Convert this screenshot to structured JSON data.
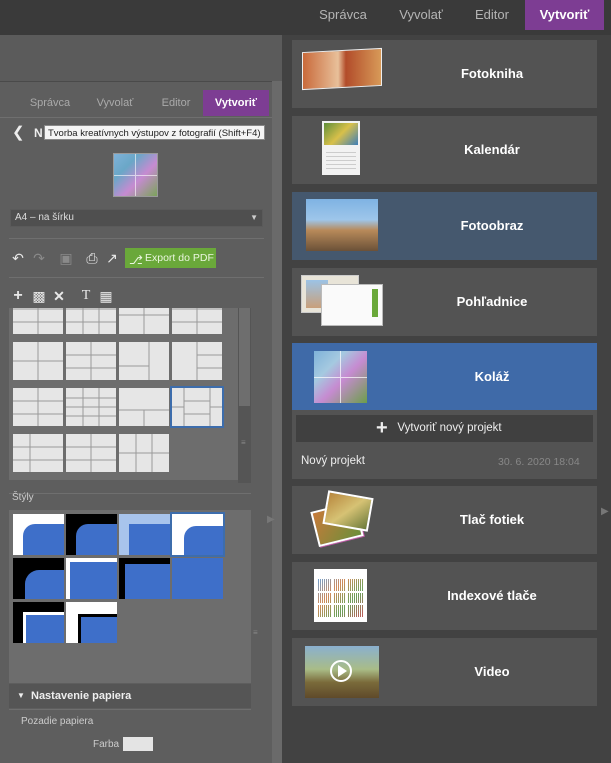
{
  "top_tabs": [
    "Správca",
    "Vyvolať",
    "Editor",
    "Vytvoriť"
  ],
  "panel": {
    "tabs": [
      "Správca",
      "Vyvolať",
      "Editor",
      "Vytvoriť"
    ],
    "title_initial": "N",
    "tooltip": "Tvorba kreatívnych výstupov z fotografií (Shift+F4)",
    "format_select": "A4 – na šírku",
    "export_label": "Export do PDF",
    "styles_label": "Štýly",
    "paper_settings_label": "Nastavenie papiera",
    "paper_background_label": "Pozadie papiera",
    "color_label": "Farba"
  },
  "sidebar": {
    "items": [
      {
        "label": "Fotokniha"
      },
      {
        "label": "Kalendár"
      },
      {
        "label": "Fotoobraz"
      },
      {
        "label": "Pohľadnice"
      },
      {
        "label": "Koláž"
      },
      {
        "label": "Tlač fotiek"
      },
      {
        "label": "Indexové tlače"
      },
      {
        "label": "Video"
      }
    ],
    "create_new_project": "Vytvoriť nový projekt",
    "project_name": "Nový projekt",
    "project_date": "30. 6. 2020 18:04"
  },
  "colors": {
    "accent_purple": "#7d3d93",
    "accent_blue": "#3f6aa8",
    "export_green": "#6aa83a"
  }
}
